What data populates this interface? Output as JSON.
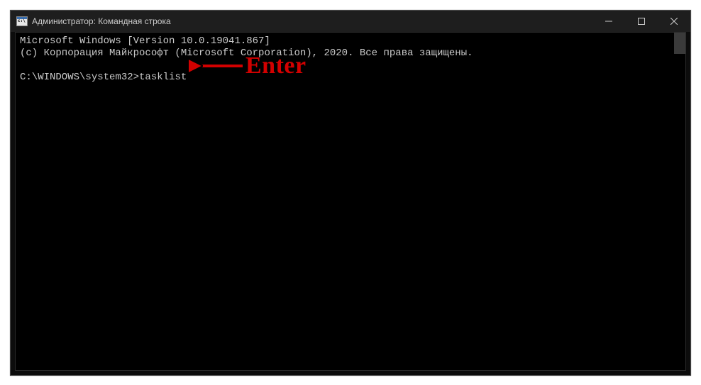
{
  "titlebar": {
    "title": "Администратор: Командная строка"
  },
  "terminal": {
    "line1": "Microsoft Windows [Version 10.0.19041.867]",
    "line2": "(c) Корпорация Майкрософт (Microsoft Corporation), 2020. Все права защищены.",
    "prompt": "C:\\WINDOWS\\system32>",
    "command": "tasklist"
  },
  "annotation": {
    "label": "Enter"
  }
}
